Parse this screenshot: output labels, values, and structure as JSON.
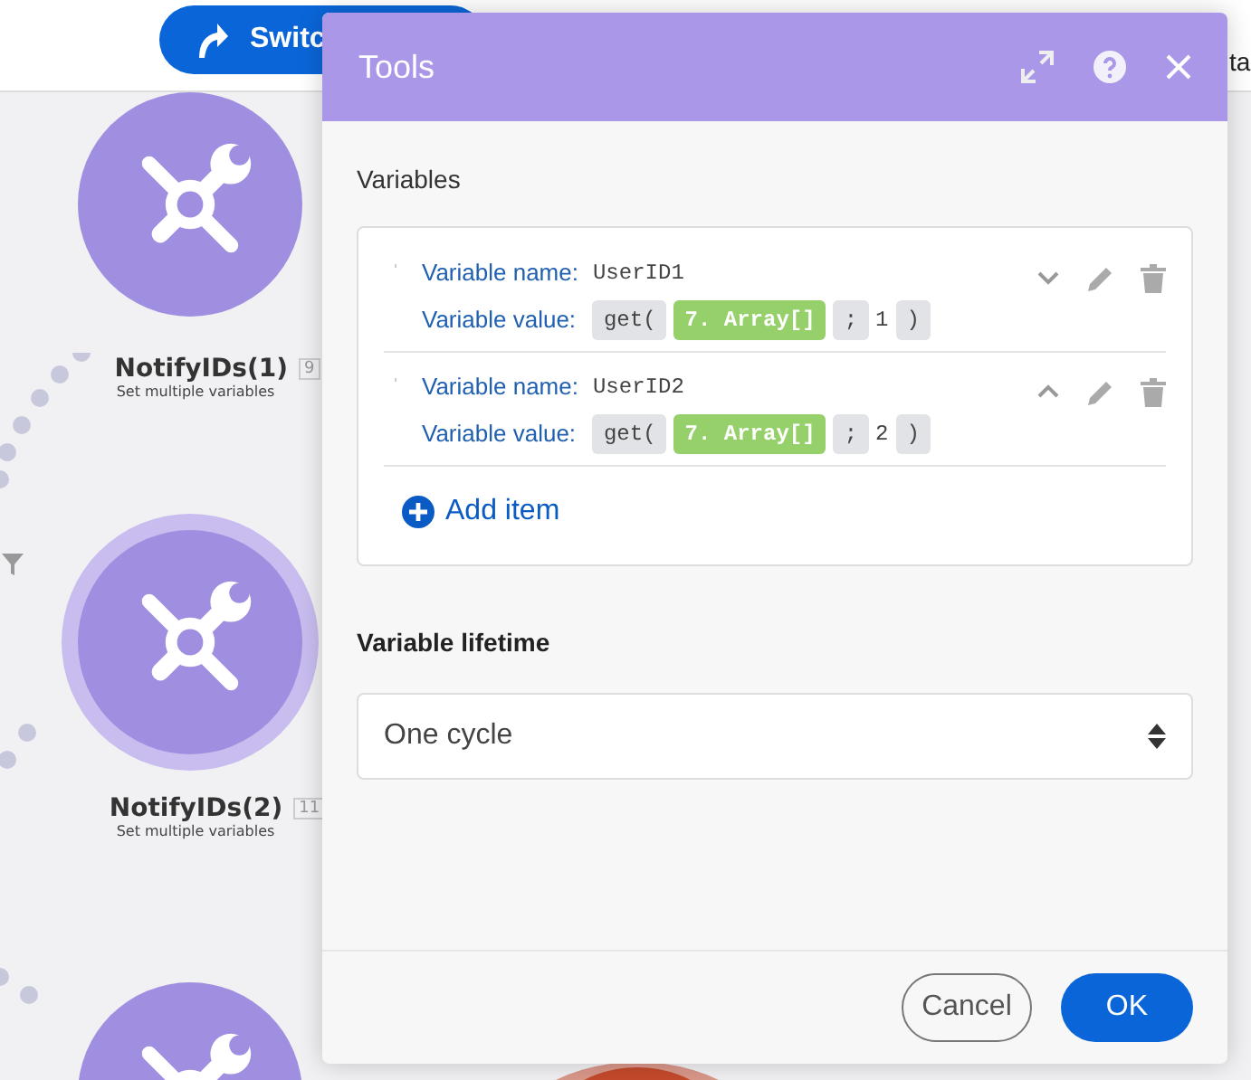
{
  "topbar": {
    "switch_button": "Switc",
    "cut_text": "ta"
  },
  "nodes": [
    {
      "name": "NotifyIDs(1)",
      "badge": "9",
      "subtitle": "Set multiple variables"
    },
    {
      "name": "NotifyIDs(2)",
      "badge": "11",
      "subtitle": "Set multiple variables"
    }
  ],
  "dialog": {
    "title": "Tools",
    "section_label": "Variables",
    "items": [
      {
        "name_label": "Variable name:",
        "name_value": "UserID1",
        "value_label": "Variable value:",
        "expanded": false,
        "tokens": [
          {
            "kind": "fn",
            "text": "get("
          },
          {
            "kind": "ref",
            "text": "7. Array[]"
          },
          {
            "kind": "sep",
            "text": ";"
          },
          {
            "kind": "text",
            "text": "1"
          },
          {
            "kind": "fn",
            "text": ")"
          }
        ]
      },
      {
        "name_label": "Variable name:",
        "name_value": "UserID2",
        "value_label": "Variable value:",
        "expanded": true,
        "tokens": [
          {
            "kind": "fn",
            "text": "get("
          },
          {
            "kind": "ref",
            "text": "7. Array[]"
          },
          {
            "kind": "sep",
            "text": ";"
          },
          {
            "kind": "text",
            "text": "2"
          },
          {
            "kind": "fn",
            "text": ")"
          }
        ]
      }
    ],
    "add_item": "Add item",
    "lifetime_label": "Variable lifetime",
    "lifetime_value": "One cycle",
    "buttons": [
      {
        "label": "Cancel",
        "kind": "secondary"
      },
      {
        "label": "OK",
        "kind": "primary"
      }
    ]
  }
}
